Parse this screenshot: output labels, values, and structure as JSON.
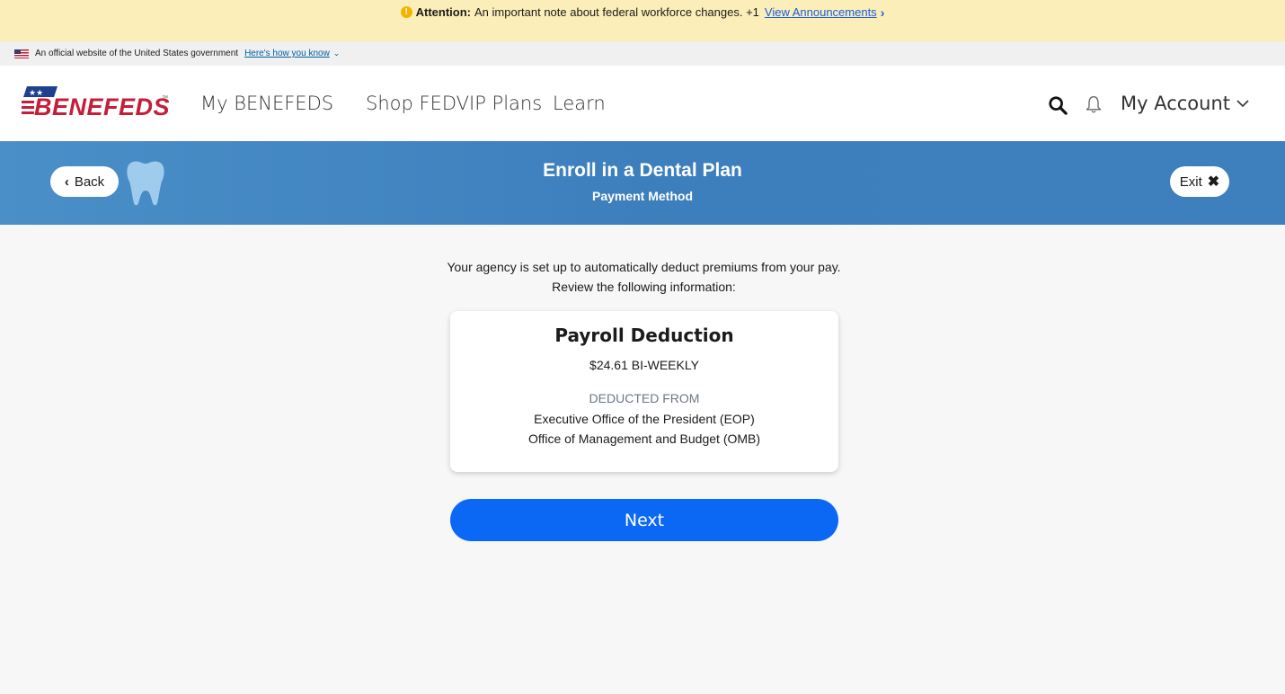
{
  "announcement": {
    "label": "Attention:",
    "text": "An important note about federal workforce changes. +1",
    "link": "View Announcements"
  },
  "gov_banner": {
    "text": "An official website of the United States government",
    "link": "Here's how you know"
  },
  "header": {
    "logo": "BENEFEDS",
    "nav": [
      "My BENEFEDS",
      "Shop FEDVIP Plans",
      "Learn"
    ],
    "account": "My Account"
  },
  "banner": {
    "back": "Back",
    "title": "Enroll in a Dental Plan",
    "subtitle": "Payment Method",
    "exit": "Exit"
  },
  "content": {
    "intro_line1": "Your agency is set up to automatically deduct premiums from your pay.",
    "intro_line2": "Review the following information:",
    "card": {
      "title": "Payroll Deduction",
      "amount": "$24.61 BI-WEEKLY",
      "label": "DEDUCTED FROM",
      "line1": "Executive Office of the President (EOP)",
      "line2": "Office of Management and Budget (OMB)"
    },
    "next": "Next"
  },
  "colors": {
    "announcement_bg": "#fbeeb8",
    "banner_blue": "#3e7fbe",
    "button_blue": "#0b68f5",
    "logo_red": "#c41e3a",
    "logo_blue": "#1f3f8f"
  }
}
